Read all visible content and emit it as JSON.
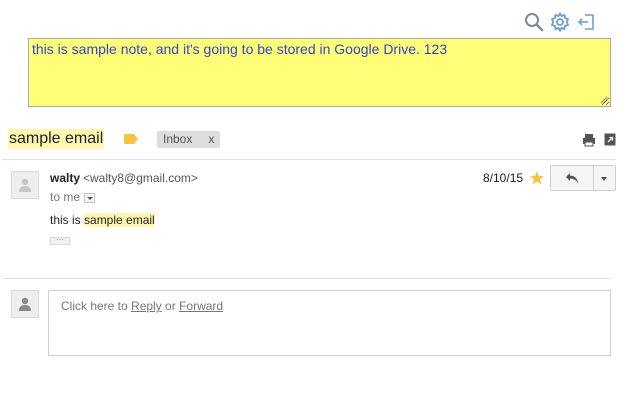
{
  "toolbar": {
    "search_icon": "search-icon",
    "settings_icon": "gear-icon",
    "logout_icon": "sign-out-icon",
    "icon_color": "#6a9fd8"
  },
  "note": {
    "text": "this is sample note, and it's going to be stored in Google Drive. 123",
    "background": "#ffff77",
    "text_color": "#3344cc"
  },
  "thread": {
    "subject": "sample email",
    "label_color": "#f6c344",
    "label": "Inbox",
    "label_remove": "x"
  },
  "message": {
    "sender_name": "walty",
    "sender_email": "<walty8@gmail.com>",
    "recipient": "to me",
    "date": "8/10/15",
    "starred": true,
    "body_prefix": "this is ",
    "body_highlight": "sample email",
    "trimmed_indicator": "···"
  },
  "reply": {
    "prompt_prefix": "Click here to ",
    "reply_link": "Reply",
    "or_text": " or ",
    "forward_link": "Forward"
  }
}
